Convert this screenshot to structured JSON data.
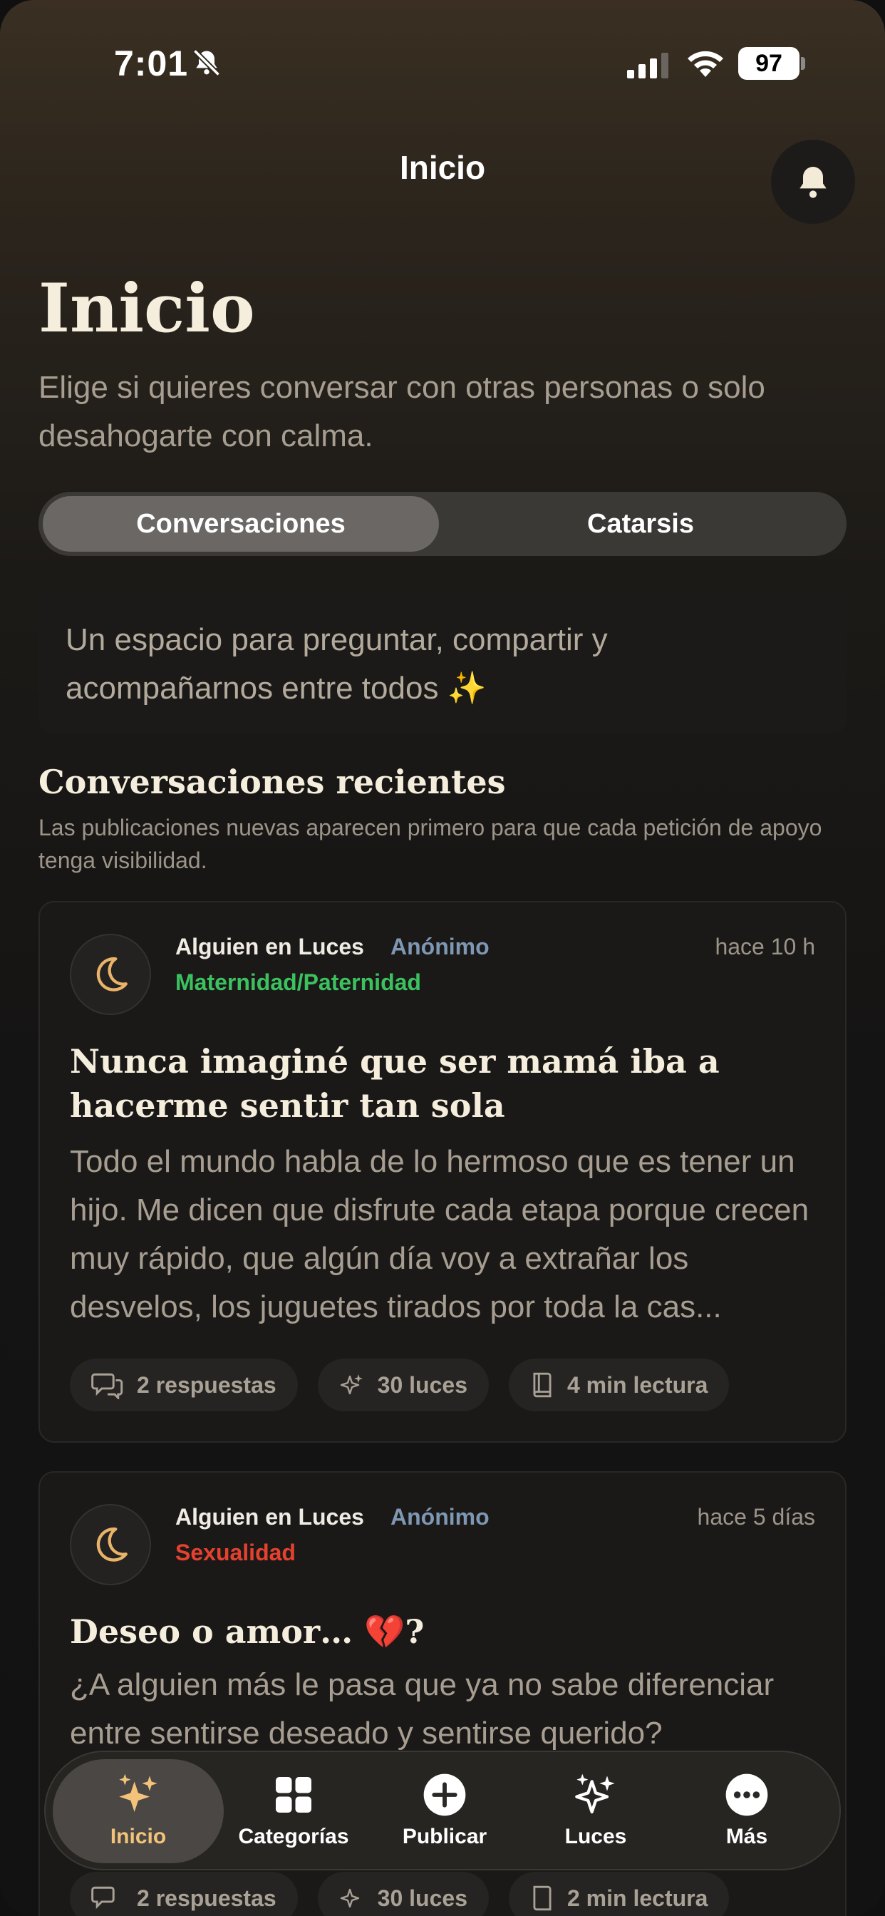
{
  "status_bar": {
    "time": "7:01",
    "battery": "97"
  },
  "header": {
    "title": "Inicio"
  },
  "page": {
    "title": "Inicio",
    "subtitle": "Elige si quieres conversar con otras personas o solo desahogarte con calma."
  },
  "segment": {
    "options": [
      "Conversaciones",
      "Catarsis"
    ],
    "selected": "Conversaciones"
  },
  "intro": {
    "text": "Un espacio para preguntar, compartir y acompañarnos entre todos ✨"
  },
  "section": {
    "title": "Conversaciones recientes",
    "subtitle": "Las publicaciones nuevas aparecen primero para que cada petición de apoyo tenga visibilidad."
  },
  "posts": [
    {
      "author": "Alguien en Luces",
      "badge": "Anónimo",
      "category": "Maternidad/Paternidad",
      "category_color": "#3cc15f",
      "time": "hace 10 h",
      "title": "Nunca imaginé que ser mamá iba a hacerme sentir tan sola",
      "body": "Todo el mundo habla de lo hermoso que es tener un hijo. Me dicen que disfrute cada etapa porque crecen muy rápido, que algún día voy a extrañar los desvelos, los juguetes tirados por toda la cas...",
      "replies": "2 respuestas",
      "lights": "30 luces",
      "read": "4 min lectura"
    },
    {
      "author": "Alguien en Luces",
      "badge": "Anónimo",
      "category": "Sexualidad",
      "category_color": "#e5412f",
      "time": "hace 5 días",
      "title": "Deseo o amor… 💔?",
      "body": "¿A alguien más le pasa que ya no sabe diferenciar entre sentirse deseado y sentirse querido?",
      "replies": "2 respuestas",
      "lights": "30 luces",
      "read": "2 min lectura"
    }
  ],
  "tabbar": {
    "items": [
      {
        "label": "Inicio",
        "icon": "sparkles-icon",
        "active": true
      },
      {
        "label": "Categorías",
        "icon": "grid-icon",
        "active": false
      },
      {
        "label": "Publicar",
        "icon": "plus-circle-icon",
        "active": false
      },
      {
        "label": "Luces",
        "icon": "sparkles-outline-icon",
        "active": false
      },
      {
        "label": "Más",
        "icon": "more-icon",
        "active": false
      }
    ]
  },
  "colors": {
    "accent_gold": "#f3c37a",
    "anon_blue": "#7e97b3",
    "background": "#121212"
  }
}
